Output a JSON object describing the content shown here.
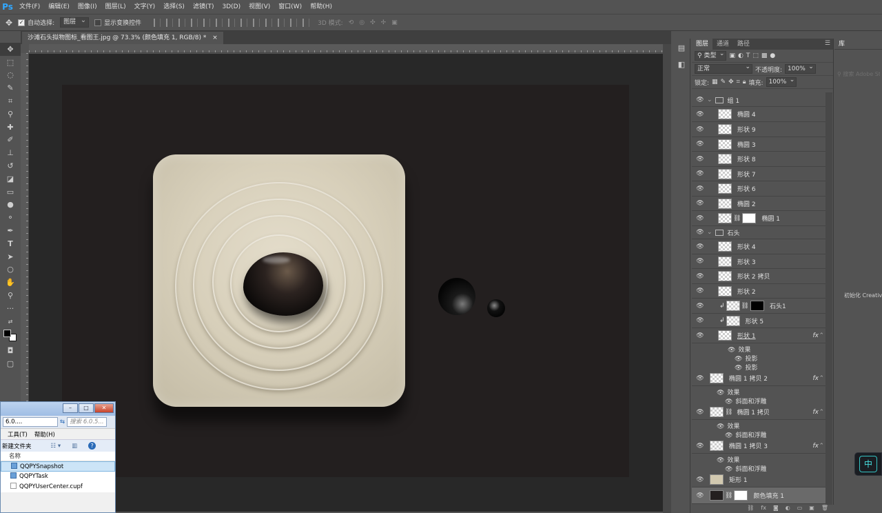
{
  "app": {
    "logo": "Ps"
  },
  "menu": [
    "文件(F)",
    "编辑(E)",
    "图像(I)",
    "图层(L)",
    "文字(Y)",
    "选择(S)",
    "滤镜(T)",
    "3D(D)",
    "视图(V)",
    "窗口(W)",
    "帮助(H)"
  ],
  "options": {
    "auto_select_label": "自动选择:",
    "auto_select_value": "图层",
    "show_transform_label": "显示变换控件",
    "mode_3d_label": "3D 模式:"
  },
  "document": {
    "tab_title": "沙滩石头拟物图标_看图王.jpg @ 73.3% (颜色填充 1, RGB/8) *",
    "tab_close": "×"
  },
  "explorer": {
    "path": "6.0....",
    "search_placeholder": "搜索 6.0.5...",
    "menu": [
      "工具(T)",
      "帮助(H)"
    ],
    "new_folder": "新建文件夹",
    "column_name": "名称",
    "files": [
      "QQPYSnapshot",
      "QQPYTask",
      "QQPYUserCenter.cupf"
    ]
  },
  "layers_panel": {
    "tabs": [
      "图层",
      "通道",
      "路径"
    ],
    "filter_kind": "类型",
    "blend_mode": "正常",
    "opacity_label": "不透明度:",
    "opacity_value": "100%",
    "lock_label": "锁定:",
    "fill_label": "填充:",
    "fill_value": "100%",
    "layers": [
      {
        "name": "组 1",
        "type": "group"
      },
      {
        "name": "椭圆 4",
        "type": "layer"
      },
      {
        "name": "形状 9",
        "type": "layer"
      },
      {
        "name": "椭圆 3",
        "type": "layer"
      },
      {
        "name": "形状 8",
        "type": "layer"
      },
      {
        "name": "形状 7",
        "type": "layer"
      },
      {
        "name": "形状 6",
        "type": "layer"
      },
      {
        "name": "椭圆 2",
        "type": "layer"
      },
      {
        "name": "椭圆 1",
        "type": "masked"
      },
      {
        "name": "石头",
        "type": "group"
      },
      {
        "name": "形状 4",
        "type": "layer"
      },
      {
        "name": "形状 3",
        "type": "layer"
      },
      {
        "name": "形状 2 拷贝",
        "type": "layer"
      },
      {
        "name": "形状 2",
        "type": "layer"
      },
      {
        "name": "石头1",
        "type": "masked"
      },
      {
        "name": "形状 5",
        "type": "layer"
      },
      {
        "name": "形状 1",
        "type": "fx"
      },
      {
        "name": "椭圆 1 拷贝 2",
        "type": "fx"
      },
      {
        "name": "椭圆 1 拷贝",
        "type": "fx"
      },
      {
        "name": "椭圆 1 拷贝 3",
        "type": "fx"
      },
      {
        "name": "矩形 1",
        "type": "layer"
      },
      {
        "name": "颜色填充 1",
        "type": "masked"
      }
    ],
    "effects_label": "效果",
    "fx_label": "fx",
    "effect_shadow": "投影",
    "effect_bevel": "斜面和浮雕"
  },
  "library": {
    "tab": "库",
    "search_placeholder": "搜索 Adobe Stock",
    "status": "初始化 Creative"
  },
  "ime": {
    "label": "中"
  },
  "colors": {
    "accent": "#31a8ff",
    "canvas": "#231f1f",
    "workspace": "#282828"
  }
}
